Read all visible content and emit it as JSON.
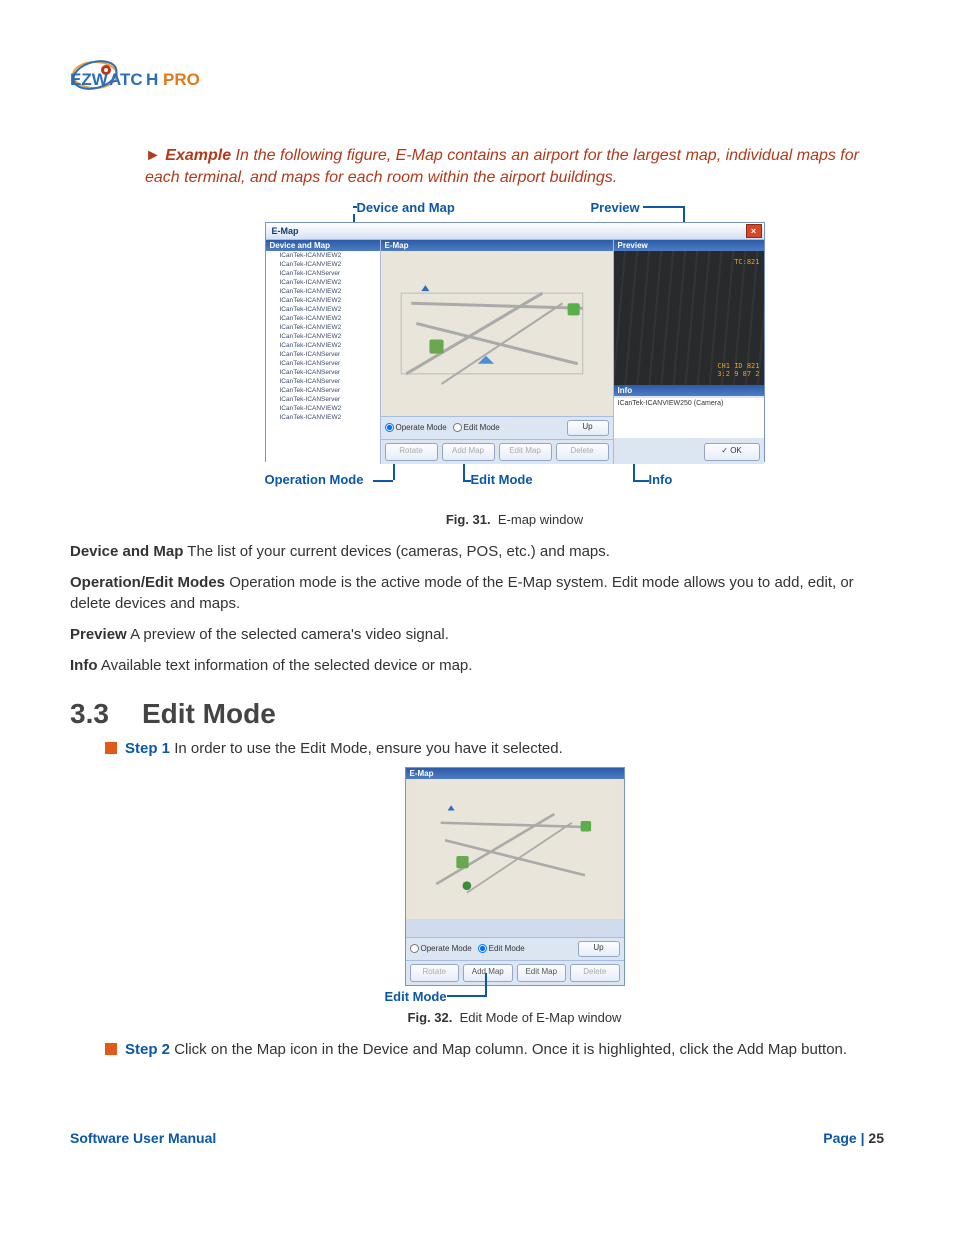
{
  "logo_text": "EZWATCH PRO",
  "example": {
    "label": "Example",
    "text": "In the following figure, E-Map contains an airport for the largest map, individual maps for each terminal, and maps for each room within the airport buildings."
  },
  "callouts31": {
    "device_and_map": "Device and Map",
    "preview": "Preview",
    "operation_mode": "Operation Mode",
    "edit_mode": "Edit Mode",
    "info": "Info"
  },
  "callouts32": {
    "edit_mode": "Edit Mode"
  },
  "win": {
    "title": "E-Map",
    "close": "×",
    "panels": {
      "device": "Device and Map",
      "emap": "E-Map",
      "preview": "Preview",
      "info": "Info"
    },
    "devices": [
      "ICanTek-ICANVIEW2",
      "ICanTek-ICANVIEW2",
      "ICanTek-ICANServer",
      "ICanTek-ICANVIEW2",
      "ICanTek-ICANVIEW2",
      "ICanTek-ICANVIEW2",
      "ICanTek-ICANVIEW2",
      "ICanTek-ICANVIEW2",
      "ICanTek-ICANVIEW2",
      "ICanTek-ICANVIEW2",
      "ICanTek-ICANVIEW2",
      "ICanTek-ICANServer",
      "ICanTek-ICANServer",
      "ICanTek-ICANServer",
      "ICanTek-ICANServer",
      "ICanTek-ICANServer",
      "ICanTek-ICANServer",
      "ICanTek-ICANVIEW2",
      "ICanTek-ICANVIEW2"
    ],
    "mode": {
      "operate": "Operate Mode",
      "edit": "Edit Mode"
    },
    "buttons": {
      "up": "Up",
      "rotate": "Rotate",
      "addmap": "Add Map",
      "editmap": "Edit Map",
      "delete": "Delete",
      "ok": "OK"
    },
    "preview_labels": {
      "tc": "TC:821",
      "l1": "CH1 ID 821",
      "l2": "3:2 9 87 2"
    },
    "info_text": "ICanTek-ICANVIEW250 (Camera)"
  },
  "fig31": {
    "label": "Fig. 31.",
    "caption": "E-map window"
  },
  "fig32": {
    "label": "Fig. 32.",
    "caption": "Edit Mode of E-Map window"
  },
  "defs": {
    "d1t": "Device and Map",
    "d1": "The list of your current devices (cameras, POS, etc.) and maps.",
    "d2t": "Operation/Edit Modes",
    "d2": "Operation mode is the active mode of the E-Map system. Edit mode allows you to add, edit, or delete devices and maps.",
    "d3t": "Preview",
    "d3": "A preview of the selected camera's video signal.",
    "d4t": "Info",
    "d4": "Available text information of the selected device or map."
  },
  "section": {
    "num": "3.3",
    "title": "Edit Mode"
  },
  "steps": {
    "s1l": "Step 1",
    "s1": "In order to use the Edit Mode, ensure you have it selected.",
    "s2l": "Step 2",
    "s2": "Click on the Map icon in the Device and Map column. Once it is highlighted, click the Add Map button."
  },
  "footer": {
    "left": "Software User Manual",
    "pageword": "Page | ",
    "pagenum": "25"
  }
}
